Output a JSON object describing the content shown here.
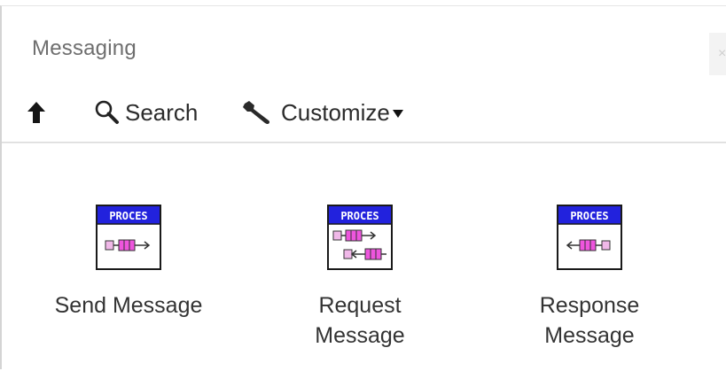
{
  "window": {
    "title": "Messaging",
    "close_glyph": "×"
  },
  "toolbar": {
    "up_icon": "up-arrow-icon",
    "search_icon": "magnifier-icon",
    "search_label": "Search",
    "customize_icon": "wrench-icon",
    "customize_label": "Customize"
  },
  "items": [
    {
      "label_lines": [
        "Send Message"
      ],
      "icon": "send-message-vi-icon",
      "icon_header": "PROCES"
    },
    {
      "label_lines": [
        "Request",
        "Message"
      ],
      "icon": "request-message-vi-icon",
      "icon_header": "PROCES"
    },
    {
      "label_lines": [
        "Response",
        "Message"
      ],
      "icon": "response-message-vi-icon",
      "icon_header": "PROCES"
    }
  ],
  "colors": {
    "icon_header_bg": "#2222dd",
    "icon_header_text": "#ffffff",
    "icon_block_pink": "#ee55dd",
    "icon_block_light": "#f0b8e8",
    "icon_border": "#1a1a1a"
  }
}
